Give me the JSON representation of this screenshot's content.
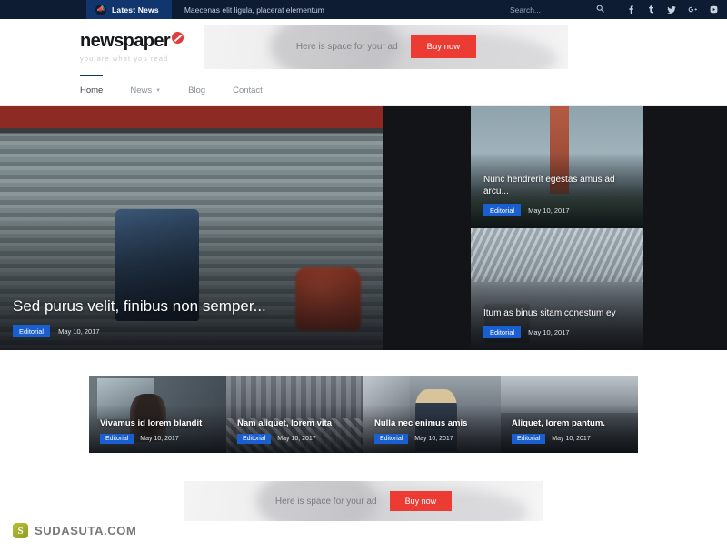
{
  "topbar": {
    "latest_news_label": "Latest News",
    "megaphone_icon": "megaphone-icon",
    "ticker_text": "Maecenas elit ligula, placerat elementum",
    "search_placeholder": "Search...",
    "search_value": "",
    "search_icon": "search-icon",
    "socials": [
      {
        "name": "facebook-icon",
        "glyph": "f"
      },
      {
        "name": "tumblr-icon",
        "glyph": "t"
      },
      {
        "name": "twitter-icon",
        "glyph": "✓"
      },
      {
        "name": "google-plus-icon",
        "glyph": "G+"
      },
      {
        "name": "youtube-icon",
        "glyph": "▶"
      }
    ]
  },
  "header": {
    "logo_text": "newspaper",
    "logo_mark": "red-circle-slash-icon",
    "tagline": "you are what you read"
  },
  "ad_top": {
    "text": "Here is space for your ad",
    "button_label": "Buy now"
  },
  "ad_bottom": {
    "text": "Here is space for your ad",
    "button_label": "Buy now"
  },
  "nav": {
    "items": [
      {
        "label": "Home",
        "active": true,
        "has_dropdown": false
      },
      {
        "label": "News",
        "active": false,
        "has_dropdown": true
      },
      {
        "label": "Blog",
        "active": false,
        "has_dropdown": false
      },
      {
        "label": "Contact",
        "active": false,
        "has_dropdown": false
      }
    ],
    "chevron_icon": "chevron-down-icon"
  },
  "hero": {
    "featured": {
      "title": "Sed purus velit, finibus non semper...",
      "category": "Editorial",
      "date": "May 10, 2017"
    },
    "side": [
      {
        "title": "Nunc hendrerit egestas amus ad arcu...",
        "category": "Editorial",
        "date": "May 10, 2017"
      },
      {
        "title": "Itum as binus sitam conestum ey",
        "category": "Editorial",
        "date": "May 10, 2017"
      }
    ]
  },
  "cards": [
    {
      "title": "Vivamus id lorem blandit",
      "category": "Editorial",
      "date": "May 10, 2017"
    },
    {
      "title": "Nam aliquet, lorem vita",
      "category": "Editorial",
      "date": "May 10, 2017"
    },
    {
      "title": "Nulla nec enimus amis",
      "category": "Editorial",
      "date": "May 10, 2017"
    },
    {
      "title": "Aliquet, lorem pantum.",
      "category": "Editorial",
      "date": "May 10, 2017"
    }
  ],
  "watermark": {
    "logo_letter": "S",
    "text": "SUDASUTA.COM"
  },
  "colors": {
    "topbar_bg": "#0d1b33",
    "badge_bg": "#11366e",
    "accent_red": "#ec3b33",
    "category_blue": "#1a5fd0",
    "hero_bg": "#131417",
    "nav_active": "#12355f"
  }
}
